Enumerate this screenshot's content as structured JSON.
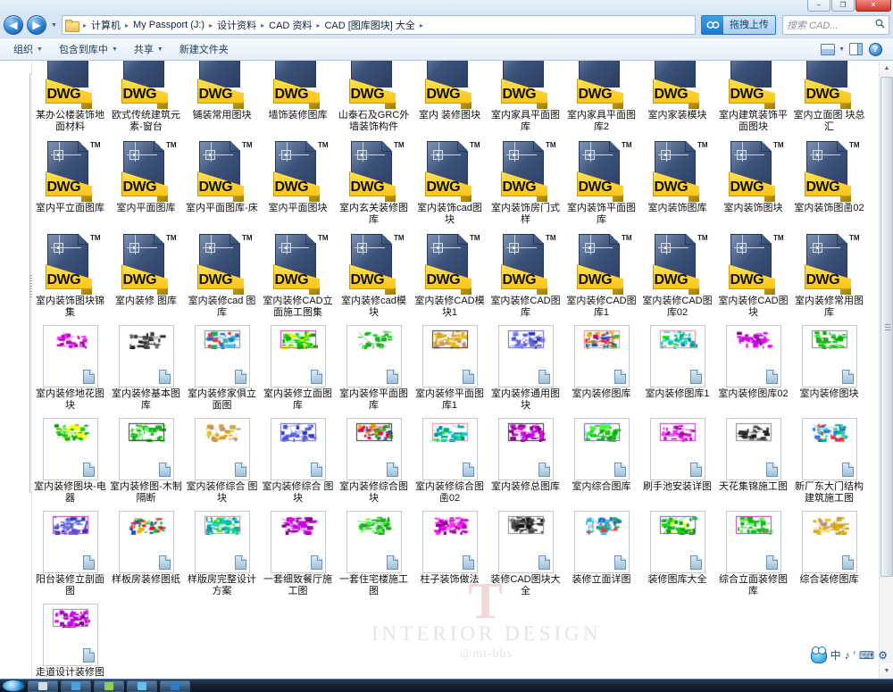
{
  "window": {
    "minimize_label": "–",
    "restore_label": "❐",
    "close_label": "✕"
  },
  "nav": {
    "back_icon": "◀",
    "forward_icon": "▶",
    "history_caret": "▼"
  },
  "address": {
    "folder_icon": "folder-icon",
    "separator": "▸",
    "crumbs": [
      "计算机",
      "My Passport (J:)",
      "设计资料",
      "CAD 资料",
      "CAD [图库图块] 大全"
    ]
  },
  "upload": {
    "label": "拖拽上传",
    "icon": "cloud-upload-icon"
  },
  "search": {
    "placeholder": "搜索 CAD...",
    "icon": "search-icon",
    "value": ""
  },
  "toolbar": {
    "items": [
      {
        "label": "组织",
        "has_caret": true
      },
      {
        "label": "包含到库中",
        "has_caret": true
      },
      {
        "label": "共享",
        "has_caret": true
      },
      {
        "label": "新建文件夹",
        "has_caret": false
      }
    ],
    "caret": "▼",
    "view_icon": "view-layout-icon",
    "pane_icon": "preview-pane-icon",
    "help_icon": "help-icon",
    "help_label": "?"
  },
  "files": {
    "dwg_badge": "DWG",
    "tm_badge": "TM",
    "rows": [
      {
        "kind": "dwg-clipped",
        "items": [
          "某办公楼装饰地面材料",
          "欧式传统建筑元素-窗台",
          "铺装常用图块",
          "墙饰装修图库",
          "山泰石及GRC外墙装饰构件",
          "室内 装修图块",
          "室内家具平面图库",
          "室内家具平面图库2",
          "室内家装模块",
          "室内建筑装饰平面图块",
          "室内立面图 块总汇"
        ]
      },
      {
        "kind": "dwg",
        "items": [
          "室内平立面图库",
          "室内平面图库",
          "室内平面图库-床",
          "室内平面图块",
          "室内玄关装修图库",
          "室内装饰cad图块",
          "室内装饰房门式样",
          "室内装饰平面图库",
          "室内装饰图库",
          "室内装饰图块",
          "室内装饰图圅02"
        ]
      },
      {
        "kind": "dwg",
        "items": [
          "室内装饰图块锦集",
          "室内装修 图库",
          "室内装修cad 图库",
          "室内装修CAD立面施工图集",
          "室内装修cad模块",
          "室内装修CAD模块1",
          "室内装修CAD图库",
          "室内装修CAD图库1",
          "室内装修CAD图库02",
          "室内装修CAD图块",
          "室内装修常用图库"
        ]
      },
      {
        "kind": "thumb",
        "items": [
          "室内装修地花图块",
          "室内装修基本图库",
          "室内装修家俱立面图",
          "室内装修立面图库",
          "室内装修平面图库",
          "室内装修平面图库1",
          "室内装修通用图块",
          "室内装修图库",
          "室内装修图库1",
          "室内装修图库02",
          "室内装修图块"
        ]
      },
      {
        "kind": "thumb",
        "items": [
          "室内装修图块-电器",
          "室内装修图-木制隔断",
          "室内装修综合 图块",
          "室内装修综合 图块",
          "室内装修综合图块",
          "室内装修综合图圅02",
          "室内装修总图库",
          "室内综合图库",
          "刷手池安装详图",
          "天花集锦施工图",
          "新厂东大门结构建筑施工图"
        ]
      },
      {
        "kind": "thumb",
        "items": [
          "阳台装修立剖面图",
          "样板房装修图纸",
          "样版房完整设计方案",
          "一套细致餐厅施工图",
          "一套住宅楼施工图",
          "柱子装饰做法",
          "装修CAD图块大全",
          "装修立面详图",
          "装修图库大全",
          "综合立面装修图库",
          "综合装修图库"
        ]
      },
      {
        "kind": "thumb",
        "items": [
          "走道设计装修图"
        ]
      }
    ]
  },
  "watermark": {
    "logo": "T",
    "line1": "INTERIOR DESIGN",
    "line2": "@mt-bbs"
  },
  "scrollbar": {
    "up_arrow": "▲",
    "down_arrow": "▼"
  },
  "tray": {
    "items": [
      {
        "name": "ime-penguin-icon",
        "glyph": ""
      },
      {
        "name": "ime-chinese-mode",
        "glyph": "中"
      },
      {
        "name": "ime-punctuation",
        "glyph": "♪"
      },
      {
        "name": "ime-halfwidth",
        "glyph": "′"
      },
      {
        "name": "ime-softkeyboard",
        "glyph": "⌨"
      },
      {
        "name": "ime-settings-gear",
        "glyph": "⚙"
      }
    ]
  },
  "taskbar": {
    "start_label": "start-orb",
    "buttons": [
      {
        "name": "taskbar-item-1",
        "color": "#d8dde2"
      },
      {
        "name": "taskbar-item-2",
        "color": "#4aa3dd"
      },
      {
        "name": "taskbar-item-3",
        "color": "#8fd14f"
      },
      {
        "name": "taskbar-item-4",
        "color": "#63c2e8"
      },
      {
        "name": "taskbar-item-5",
        "color": "#2d7cc0"
      }
    ],
    "clock": ""
  },
  "colors": {
    "accent": "#2a81d6",
    "dwg_yellow": "#fcc417",
    "dwg_blue": "#2c3f63",
    "chrome": "#d7e5f4"
  }
}
